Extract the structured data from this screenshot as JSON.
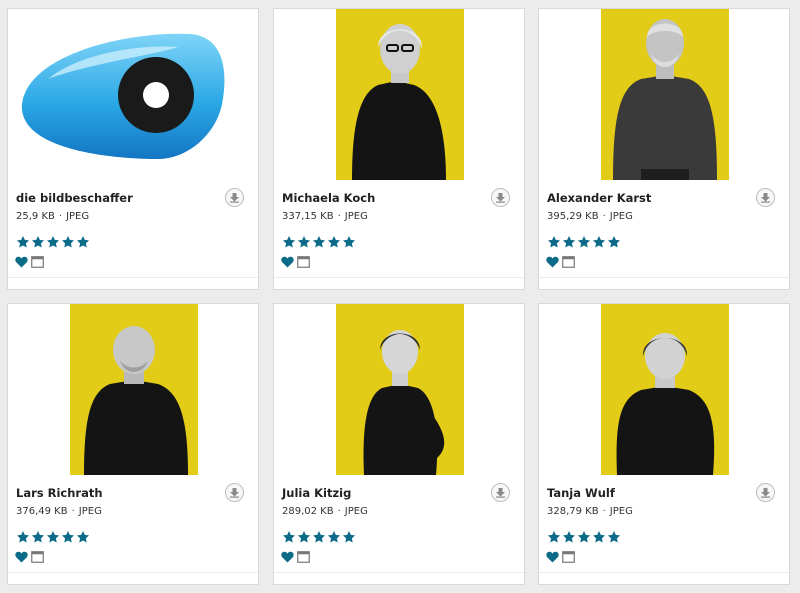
{
  "accent_color": "#0d6b8a",
  "photo_background": "#e2cc17",
  "cards": [
    {
      "title": "die bildbeschaffer",
      "size": "25,9 KB",
      "format": "JPEG",
      "rating": 5,
      "image": "logo-eye-icon"
    },
    {
      "title": "Michaela Koch",
      "size": "337,15 KB",
      "format": "JPEG",
      "rating": 5,
      "image": "portrait-photo"
    },
    {
      "title": "Alexander Karst",
      "size": "395,29 KB",
      "format": "JPEG",
      "rating": 5,
      "image": "portrait-photo"
    },
    {
      "title": "Lars Richrath",
      "size": "376,49 KB",
      "format": "JPEG",
      "rating": 5,
      "image": "portrait-photo"
    },
    {
      "title": "Julia Kitzig",
      "size": "289,02 KB",
      "format": "JPEG",
      "rating": 5,
      "image": "portrait-photo"
    },
    {
      "title": "Tanja Wulf",
      "size": "328,79 KB",
      "format": "JPEG",
      "rating": 5,
      "image": "portrait-photo"
    }
  ],
  "icons": {
    "download": "download-icon",
    "star": "star-icon",
    "favorite": "heart-icon",
    "preview": "window-icon"
  }
}
